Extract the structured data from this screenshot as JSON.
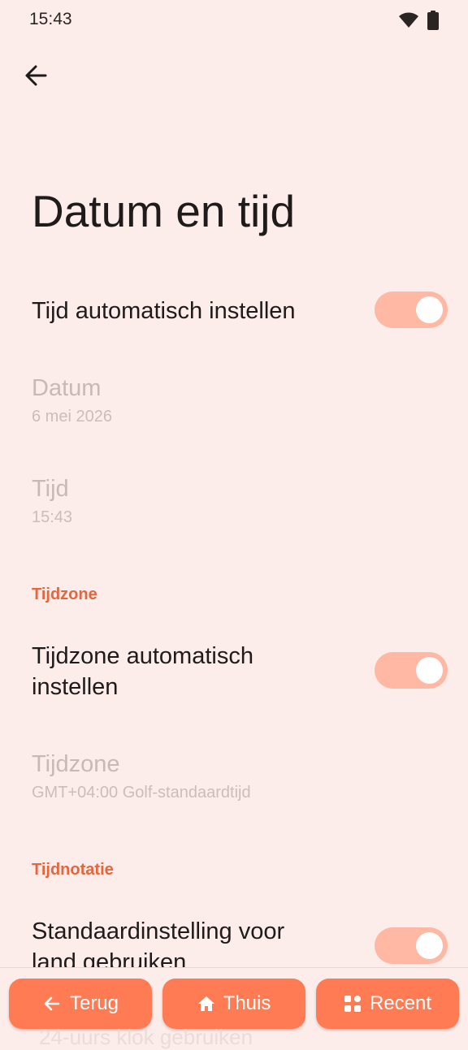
{
  "status_bar": {
    "time": "15:43",
    "icons": [
      "wifi-icon",
      "battery-icon"
    ]
  },
  "header": {
    "back_icon": "arrow-left-icon",
    "title": "Datum en tijd"
  },
  "settings": {
    "auto_time": {
      "label": "Tijd automatisch instellen",
      "enabled": true
    },
    "date": {
      "label": "Datum",
      "value": "6 mei 2026"
    },
    "time": {
      "label": "Tijd",
      "value": "15:43"
    },
    "timezone_section": "Tijdzone",
    "auto_timezone": {
      "label_line1": "Tijdzone automatisch",
      "label_line2": "instellen",
      "enabled": true
    },
    "timezone": {
      "label": "Tijdzone",
      "value": "GMT+04:00 Golf-standaardtijd"
    },
    "format_section": "Tijdnotatie",
    "locale_default": {
      "label_line1": "Standaardinstelling voor",
      "label_line2": "land gebruiken",
      "enabled": true
    },
    "peek_item": "24-uurs klok gebruiken"
  },
  "nav": {
    "back": {
      "label": "Terug",
      "icon": "arrow-left-icon"
    },
    "home": {
      "label": "Thuis",
      "icon": "home-icon"
    },
    "recent": {
      "label": "Recent",
      "icon": "grid-icon"
    }
  },
  "colors": {
    "background": "#fcecea",
    "accent": "#e2673f",
    "toggle_track": "#ffb8a3",
    "nav_button": "#ff7b54"
  }
}
